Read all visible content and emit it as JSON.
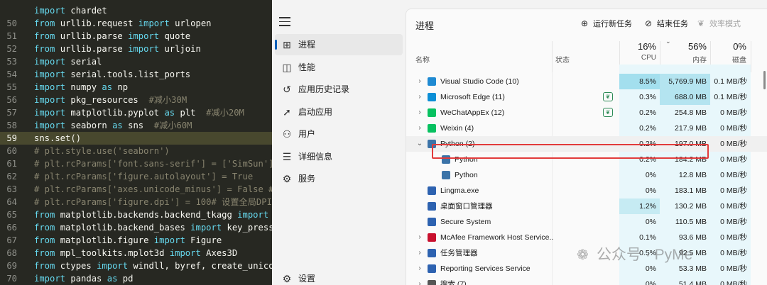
{
  "editor": {
    "lines": [
      {
        "n": "",
        "tokens": [
          {
            "t": "import",
            "c": "kw"
          },
          {
            "t": " chardet",
            "c": ""
          }
        ]
      },
      {
        "n": "50",
        "tokens": [
          {
            "t": "from",
            "c": "kw"
          },
          {
            "t": " urllib.request ",
            "c": ""
          },
          {
            "t": "import",
            "c": "kw"
          },
          {
            "t": " urlopen",
            "c": ""
          }
        ]
      },
      {
        "n": "51",
        "tokens": [
          {
            "t": "from",
            "c": "kw"
          },
          {
            "t": " urllib.parse ",
            "c": ""
          },
          {
            "t": "import",
            "c": "kw"
          },
          {
            "t": " quote",
            "c": ""
          }
        ]
      },
      {
        "n": "52",
        "tokens": [
          {
            "t": "from",
            "c": "kw"
          },
          {
            "t": " urllib.parse ",
            "c": ""
          },
          {
            "t": "import",
            "c": "kw"
          },
          {
            "t": " urljoin",
            "c": ""
          }
        ]
      },
      {
        "n": "53",
        "tokens": [
          {
            "t": "import",
            "c": "kw"
          },
          {
            "t": " serial",
            "c": ""
          }
        ]
      },
      {
        "n": "54",
        "tokens": [
          {
            "t": "import",
            "c": "kw"
          },
          {
            "t": " serial.tools.list_ports",
            "c": ""
          }
        ]
      },
      {
        "n": "55",
        "tokens": [
          {
            "t": "import",
            "c": "kw"
          },
          {
            "t": " numpy ",
            "c": ""
          },
          {
            "t": "as",
            "c": "kw"
          },
          {
            "t": " np",
            "c": ""
          }
        ]
      },
      {
        "n": "56",
        "tokens": [
          {
            "t": "import",
            "c": "kw"
          },
          {
            "t": " pkg_resources  ",
            "c": ""
          },
          {
            "t": "#减小30M",
            "c": "cm"
          }
        ]
      },
      {
        "n": "57",
        "tokens": [
          {
            "t": "import",
            "c": "kw"
          },
          {
            "t": " matplotlib.pyplot ",
            "c": ""
          },
          {
            "t": "as",
            "c": "kw"
          },
          {
            "t": " plt  ",
            "c": ""
          },
          {
            "t": "#减小20M",
            "c": "cm"
          }
        ]
      },
      {
        "n": "58",
        "tokens": [
          {
            "t": "import",
            "c": "kw"
          },
          {
            "t": " seaborn ",
            "c": ""
          },
          {
            "t": "as",
            "c": "kw"
          },
          {
            "t": " sns  ",
            "c": ""
          },
          {
            "t": "#减小60M",
            "c": "cm"
          }
        ]
      },
      {
        "n": "59",
        "hl": true,
        "tokens": [
          {
            "t": "sns.set()",
            "c": ""
          }
        ]
      },
      {
        "n": "60",
        "tokens": [
          {
            "t": "# plt.style.use('seaborn')",
            "c": "cm"
          }
        ]
      },
      {
        "n": "61",
        "tokens": [
          {
            "t": "# plt.rcParams['font.sans-serif'] = ['SimSun']",
            "c": "cm"
          }
        ]
      },
      {
        "n": "62",
        "tokens": [
          {
            "t": "# plt.rcParams['figure.autolayout'] = True",
            "c": "cm"
          }
        ]
      },
      {
        "n": "63",
        "tokens": [
          {
            "t": "# plt.rcParams['axes.unicode_minus'] = False #",
            "c": "cm"
          }
        ]
      },
      {
        "n": "64",
        "tokens": [
          {
            "t": "# plt.rcParams['figure.dpi'] = 100# 设置全局DPI",
            "c": "cm"
          }
        ]
      },
      {
        "n": "65",
        "tokens": [
          {
            "t": "from",
            "c": "kw"
          },
          {
            "t": " matplotlib.backends.backend_tkagg ",
            "c": ""
          },
          {
            "t": "import",
            "c": "kw"
          }
        ]
      },
      {
        "n": "66",
        "tokens": [
          {
            "t": "from",
            "c": "kw"
          },
          {
            "t": " matplotlib.backend_bases ",
            "c": ""
          },
          {
            "t": "import",
            "c": "kw"
          },
          {
            "t": " key_press",
            "c": ""
          }
        ]
      },
      {
        "n": "67",
        "tokens": [
          {
            "t": "from",
            "c": "kw"
          },
          {
            "t": " matplotlib.figure ",
            "c": ""
          },
          {
            "t": "import",
            "c": "kw"
          },
          {
            "t": " Figure",
            "c": ""
          }
        ]
      },
      {
        "n": "68",
        "tokens": [
          {
            "t": "from",
            "c": "kw"
          },
          {
            "t": " mpl_toolkits.mplot3d ",
            "c": ""
          },
          {
            "t": "import",
            "c": "kw"
          },
          {
            "t": " Axes3D",
            "c": ""
          }
        ]
      },
      {
        "n": "69",
        "tokens": [
          {
            "t": "from",
            "c": "kw"
          },
          {
            "t": " ctypes ",
            "c": ""
          },
          {
            "t": "import",
            "c": "kw"
          },
          {
            "t": " windll, byref, create_unico",
            "c": ""
          }
        ]
      },
      {
        "n": "70",
        "tokens": [
          {
            "t": "import",
            "c": "kw"
          },
          {
            "t": " pandas ",
            "c": ""
          },
          {
            "t": "as",
            "c": "kw"
          },
          {
            "t": " pd",
            "c": ""
          }
        ]
      }
    ]
  },
  "sidebar": {
    "items": [
      {
        "label": "进程",
        "icon": "processes-icon",
        "glyph": "⊞",
        "active": true
      },
      {
        "label": "性能",
        "icon": "performance-icon",
        "glyph": "◫"
      },
      {
        "label": "应用历史记录",
        "icon": "history-icon",
        "glyph": "↺"
      },
      {
        "label": "启动应用",
        "icon": "startup-icon",
        "glyph": "➚"
      },
      {
        "label": "用户",
        "icon": "users-icon",
        "glyph": "⚇"
      },
      {
        "label": "详细信息",
        "icon": "details-icon",
        "glyph": "☰"
      },
      {
        "label": "服务",
        "icon": "services-icon",
        "glyph": "⚙"
      }
    ],
    "settings": {
      "label": "设置",
      "icon": "settings-icon",
      "glyph": "⚙"
    }
  },
  "panel": {
    "title": "进程",
    "toolbar": {
      "run_new_task": "运行新任务",
      "end_task": "结束任务",
      "efficiency_mode": "效率模式"
    },
    "columns": {
      "name": "名称",
      "status": "状态",
      "cpu_pct": "16%",
      "cpu": "CPU",
      "mem_pct": "56%",
      "mem": "内存",
      "disk_pct": "0%",
      "disk": "磁盘"
    },
    "rows": [
      {
        "name": "Visual Studio Code (10)",
        "cpu": "8.5%",
        "mem": "5,769.9 MB",
        "disk": "0.1 MB/秒",
        "expand": "›",
        "indent": 0,
        "color": "#1f8ad2",
        "cpuHot": 2,
        "memHot": true
      },
      {
        "name": "Microsoft Edge (11)",
        "cpu": "0.3%",
        "mem": "688.0 MB",
        "disk": "0.1 MB/秒",
        "expand": "›",
        "indent": 0,
        "color": "#0c8fd6",
        "leaf": true,
        "memHot": true
      },
      {
        "name": "WeChatAppEx (12)",
        "cpu": "0.2%",
        "mem": "254.8 MB",
        "disk": "0 MB/秒",
        "expand": "›",
        "indent": 0,
        "color": "#07c160",
        "leaf": true
      },
      {
        "name": "Weixin (4)",
        "cpu": "0.2%",
        "mem": "217.9 MB",
        "disk": "0 MB/秒",
        "expand": "›",
        "indent": 0,
        "color": "#07c160"
      },
      {
        "name": "Python (2)",
        "cpu": "0.2%",
        "mem": "197.0 MB",
        "disk": "0 MB/秒",
        "expand": "⌄",
        "indent": 0,
        "color": "#3b73a8",
        "selected": true
      },
      {
        "name": "Python",
        "cpu": "0.2%",
        "mem": "184.2 MB",
        "disk": "0 MB/秒",
        "expand": "",
        "indent": 1,
        "color": "#3b73a8"
      },
      {
        "name": "Python",
        "cpu": "0%",
        "mem": "12.8 MB",
        "disk": "0 MB/秒",
        "expand": "",
        "indent": 1,
        "color": "#3b73a8"
      },
      {
        "name": "Lingma.exe",
        "cpu": "0%",
        "mem": "183.1 MB",
        "disk": "0 MB/秒",
        "expand": "",
        "indent": 0,
        "color": "#2d62b0"
      },
      {
        "name": "桌面窗口管理器",
        "cpu": "1.2%",
        "mem": "130.2 MB",
        "disk": "0 MB/秒",
        "expand": "",
        "indent": 0,
        "color": "#2d62b0",
        "cpuHot": 1
      },
      {
        "name": "Secure System",
        "cpu": "0%",
        "mem": "110.5 MB",
        "disk": "0 MB/秒",
        "expand": "",
        "indent": 0,
        "color": "#2d62b0"
      },
      {
        "name": "McAfee Framework Host Service...",
        "cpu": "0.1%",
        "mem": "93.6 MB",
        "disk": "0 MB/秒",
        "expand": "›",
        "indent": 0,
        "color": "#c8102e"
      },
      {
        "name": "任务管理器",
        "cpu": "0.5%",
        "mem": "92.5 MB",
        "disk": "0 MB/秒",
        "expand": "›",
        "indent": 0,
        "color": "#2d62b0"
      },
      {
        "name": "Reporting Services Service",
        "cpu": "0%",
        "mem": "53.3 MB",
        "disk": "0 MB/秒",
        "expand": "›",
        "indent": 0,
        "color": "#2d62b0"
      },
      {
        "name": "搜索 (7)",
        "cpu": "0%",
        "mem": "51.4 MB",
        "disk": "0 MB/秒",
        "expand": "›",
        "indent": 0,
        "color": "#555555"
      }
    ]
  },
  "watermark": {
    "text": "公众号 · PyMe"
  }
}
